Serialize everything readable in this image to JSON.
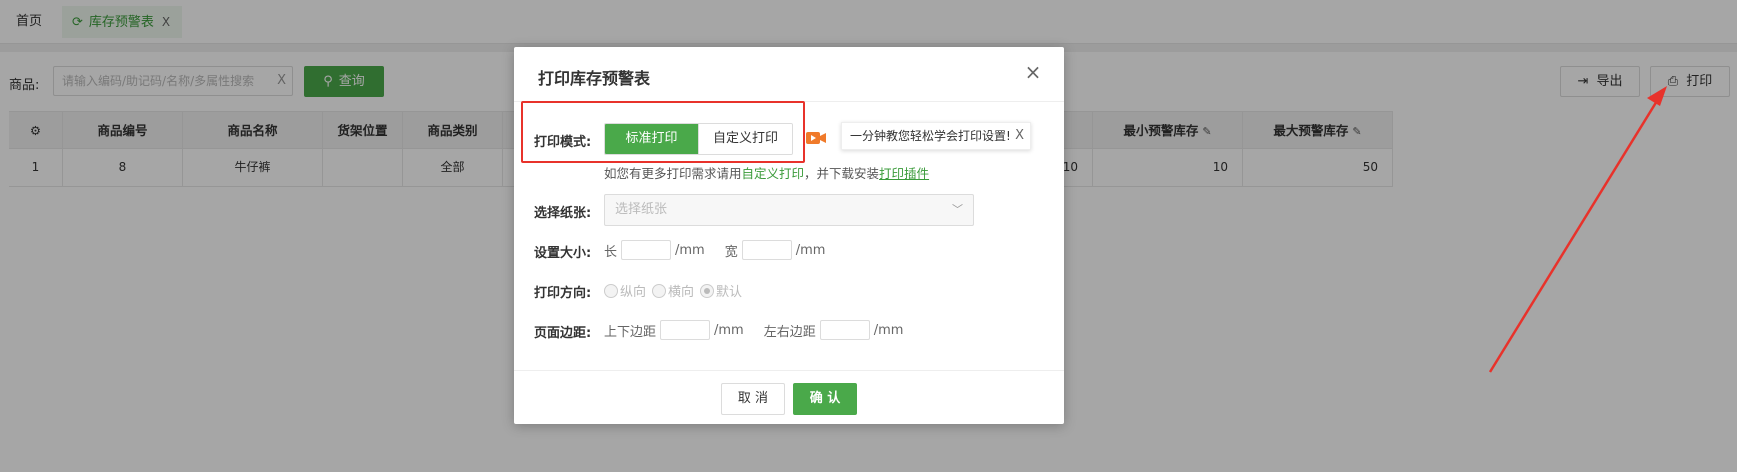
{
  "tabs": {
    "home": "首页",
    "active": "库存预警表",
    "active_close": "X"
  },
  "search": {
    "label": "商品:",
    "placeholder": "请输入编码/助记码/名称/多属性搜索",
    "clear": "X",
    "query_button": "查询"
  },
  "toolbar": {
    "export": "导出",
    "print": "打印"
  },
  "grid": {
    "columns": [
      "",
      "商品编号",
      "商品名称",
      "货架位置",
      "商品类别",
      "",
      "",
      "",
      "",
      "",
      "最小预警库存",
      "最大预警库存"
    ],
    "visible_columns": {
      "settings": "gear-icon",
      "code": "商品编号",
      "name": "商品名称",
      "location": "货架位置",
      "category": "商品类别",
      "min_stock": "最小预警库存",
      "max_stock": "最大预警库存"
    },
    "rows": [
      {
        "index": "1",
        "code": "8",
        "name": "牛仔裤",
        "location": "",
        "category": "全部",
        "hidden_value": "10",
        "min_stock": "10",
        "max_stock": "50"
      }
    ]
  },
  "dialog": {
    "title": "打印库存预警表",
    "close": "×",
    "mode_label": "打印模式:",
    "mode_standard": "标准打印",
    "mode_custom": "自定义打印",
    "tip": "一分钟教您轻松学会打印设置!",
    "tip_close": "X",
    "hint_prefix": "如您有更多打印需求请用",
    "hint_custom": "自定义打印",
    "hint_middle": "，并下载安装",
    "hint_plugin": "打印插件",
    "paper_label": "选择纸张:",
    "paper_placeholder": "选择纸张",
    "size_label": "设置大小:",
    "size_length": "长",
    "size_width": "宽",
    "unit": "/mm",
    "orientation_label": "打印方向:",
    "orientation_portrait": "纵向",
    "orientation_landscape": "横向",
    "orientation_default": "默认",
    "margin_label": "页面边距:",
    "margin_tb": "上下边距",
    "margin_lr": "左右边距",
    "cancel": "取 消",
    "ok": "确 认"
  },
  "colors": {
    "primary": "#4aa94a",
    "annotation": "#e8322b"
  }
}
